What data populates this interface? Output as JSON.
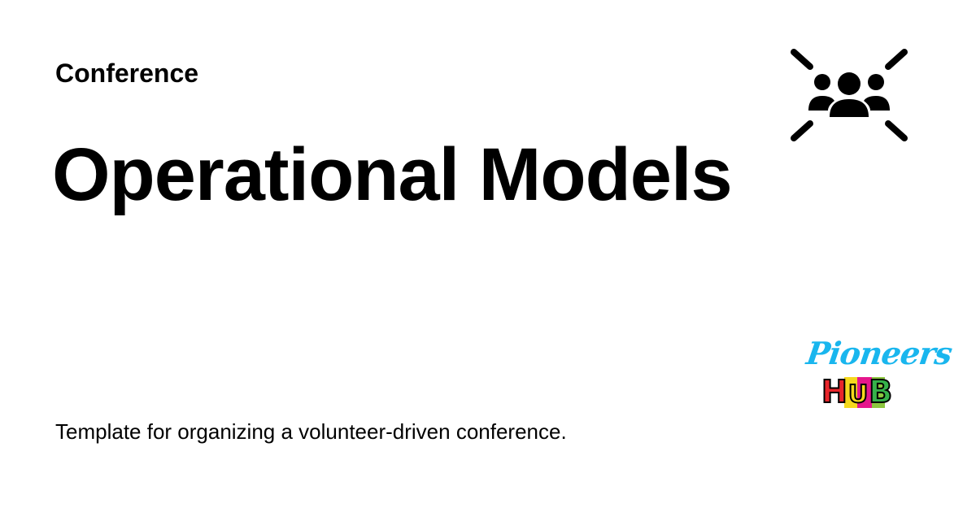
{
  "header": {
    "category": "Conference",
    "title": "Operational Models"
  },
  "footer": {
    "description": "Template for organizing a volunteer-driven conference."
  },
  "icons": {
    "main": "group-focus-icon"
  },
  "logo": {
    "top_text": "Pioneers",
    "bottom_text": "HUB",
    "letters": [
      "H",
      "U",
      "B"
    ],
    "colors": {
      "top_text": "#19b6ee",
      "letter_h": "#e8262b",
      "letter_u": "#f5d81d",
      "letter_b": "#36b24a",
      "stripe_yellow": "#f5d81d",
      "stripe_magenta": "#e5178c",
      "stripe_green": "#8cc63f"
    }
  }
}
